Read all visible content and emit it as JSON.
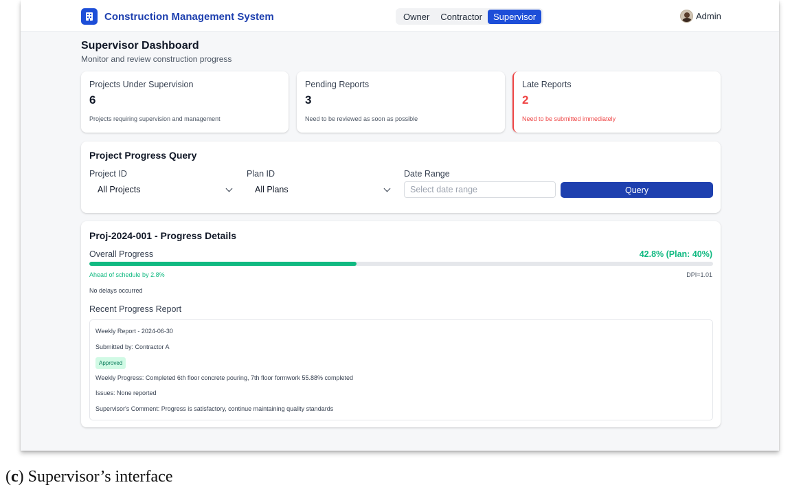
{
  "app": {
    "title": "Construction Management System",
    "roles": [
      "Owner",
      "Contractor",
      "Supervisor"
    ],
    "active_role": "Supervisor",
    "user": "Admin"
  },
  "page": {
    "title": "Supervisor Dashboard",
    "subtitle": "Monitor and review construction progress"
  },
  "stats": [
    {
      "label": "Projects Under Supervision",
      "value": "6",
      "desc": "Projects requiring supervision and management"
    },
    {
      "label": "Pending Reports",
      "value": "3",
      "desc": "Need to be reviewed as soon as possible"
    },
    {
      "label": "Late Reports",
      "value": "2",
      "desc": "Need to be submitted immediately",
      "color": "#ef4444"
    }
  ],
  "query": {
    "title": "Project Progress Query",
    "project_label": "Project ID",
    "project_value": "All Projects",
    "plan_label": "Plan ID",
    "plan_value": "All Plans",
    "date_label": "Date Range",
    "date_placeholder": "Select date range",
    "button": "Query"
  },
  "progress": {
    "title": "Proj-2024-001 - Progress Details",
    "overall_label": "Overall Progress",
    "percent_text": "42.8% (Plan: 40%)",
    "percent": 42.8,
    "ahead_text": "Ahead of schedule by 2.8%",
    "dpi": "DPI=1.01",
    "delay_text": "No delays occurred",
    "recent_title": "Recent Progress Report",
    "report": {
      "title": "Weekly Report - 2024-06-30",
      "submitted_by": "Submitted by: Contractor A",
      "status": "Approved",
      "weekly_progress": "Weekly Progress: Completed 6th floor concrete pouring, 7th floor formwork 55.88% completed",
      "issues": "Issues: None reported",
      "comment": "Supervisor's Comment: Progress is satisfactory, continue maintaining quality standards"
    }
  },
  "colors": {
    "primary": "#1e40af",
    "success": "#10b981",
    "danger": "#ef4444"
  },
  "caption": {
    "letter": "c",
    "text": " Supervisor’s interface"
  }
}
